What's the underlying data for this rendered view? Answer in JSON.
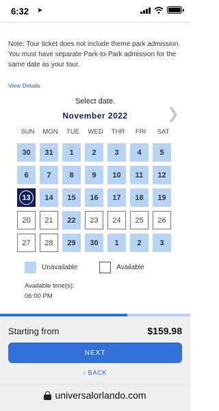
{
  "status_bar": {
    "time": "6:32",
    "location_icon": "location-arrow-icon",
    "icons": [
      "signal-icon",
      "wifi-icon",
      "battery-icon"
    ]
  },
  "note": {
    "text": "Note: Tour ticket does not include theme park admission. You must have separate Park-to-Park admission for the same date as your tour."
  },
  "view_details_label": "View Details",
  "calendar": {
    "prompt": "Select date.",
    "month_label": "November 2022",
    "next_icon": "chevron-right-icon",
    "weekdays": [
      "SUN",
      "MON",
      "TUE",
      "WED",
      "THR",
      "FRI",
      "SAT"
    ],
    "days": [
      {
        "label": "30",
        "state": "unavailable"
      },
      {
        "label": "31",
        "state": "unavailable"
      },
      {
        "label": "1",
        "state": "unavailable"
      },
      {
        "label": "2",
        "state": "unavailable"
      },
      {
        "label": "3",
        "state": "unavailable"
      },
      {
        "label": "4",
        "state": "unavailable"
      },
      {
        "label": "5",
        "state": "unavailable"
      },
      {
        "label": "6",
        "state": "unavailable"
      },
      {
        "label": "7",
        "state": "unavailable"
      },
      {
        "label": "8",
        "state": "unavailable"
      },
      {
        "label": "9",
        "state": "unavailable"
      },
      {
        "label": "10",
        "state": "unavailable"
      },
      {
        "label": "11",
        "state": "unavailable"
      },
      {
        "label": "12",
        "state": "unavailable"
      },
      {
        "label": "13",
        "state": "selected"
      },
      {
        "label": "14",
        "state": "unavailable"
      },
      {
        "label": "15",
        "state": "unavailable"
      },
      {
        "label": "16",
        "state": "unavailable"
      },
      {
        "label": "17",
        "state": "unavailable"
      },
      {
        "label": "18",
        "state": "unavailable"
      },
      {
        "label": "19",
        "state": "unavailable"
      },
      {
        "label": "20",
        "state": "available"
      },
      {
        "label": "21",
        "state": "available"
      },
      {
        "label": "22",
        "state": "unavailable"
      },
      {
        "label": "23",
        "state": "available"
      },
      {
        "label": "24",
        "state": "available"
      },
      {
        "label": "25",
        "state": "available"
      },
      {
        "label": "26",
        "state": "available"
      },
      {
        "label": "27",
        "state": "available"
      },
      {
        "label": "28",
        "state": "available"
      },
      {
        "label": "29",
        "state": "unavailable"
      },
      {
        "label": "30",
        "state": "unavailable"
      },
      {
        "label": "1",
        "state": "unavailable"
      },
      {
        "label": "2",
        "state": "unavailable"
      },
      {
        "label": "3",
        "state": "unavailable"
      }
    ]
  },
  "legend": {
    "unavailable_label": "Unavailable",
    "available_label": "Available"
  },
  "times": {
    "label": "Available time(s):",
    "value": "06:00 PM"
  },
  "progress": {
    "fraction": 0.67
  },
  "footer": {
    "starting_from_label": "Starting from",
    "price": "$159.98",
    "next_label": "NEXT",
    "back_label": "BACK"
  },
  "browser": {
    "url": "universalorlando.com"
  },
  "colors": {
    "unavailable": "#b8d4f4",
    "selected": "#0f1f5c",
    "accent": "#2f6fd6",
    "month_title": "#14246b"
  }
}
